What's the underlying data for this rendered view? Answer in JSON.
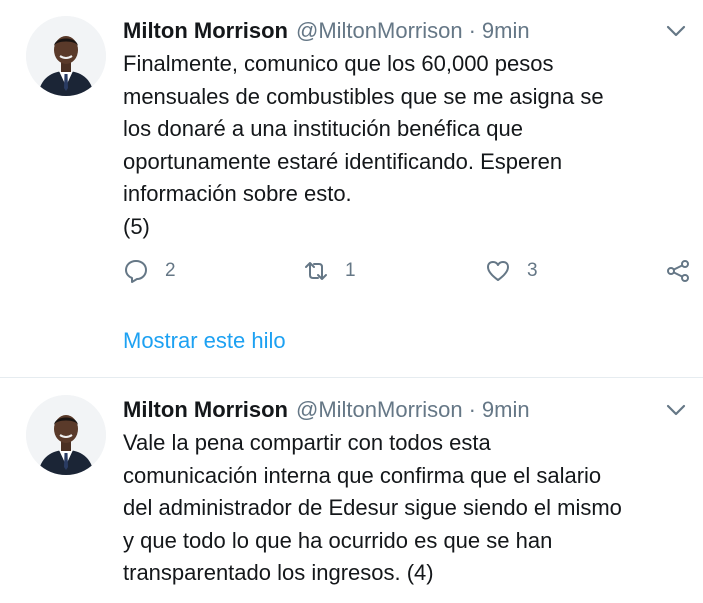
{
  "tweets": [
    {
      "name": "Milton Morrison",
      "handle": "@MiltonMorrison",
      "separator": "·",
      "time": "9min",
      "lines": [
        "Finalmente, comunico que los 60,000 pesos",
        "mensuales de combustibles que se me asigna se",
        "los donaré a una institución benéfica que",
        "oportunamente estaré identificando. Esperen",
        "información sobre esto.",
        "(5)"
      ],
      "replies": "2",
      "retweets": "1",
      "likes": "3",
      "thread_link": "Mostrar este hilo"
    },
    {
      "name": "Milton Morrison",
      "handle": "@MiltonMorrison",
      "separator": "·",
      "time": "9min",
      "lines": [
        "Vale la pena compartir con todos esta",
        "comunicación interna que confirma que el salario",
        "del administrador de Edesur sigue siendo el mismo",
        "y que todo lo que ha ocurrido es que se han",
        "transparentado los ingresos. (4)"
      ]
    }
  ],
  "icons": {
    "avatar": "profile-photo",
    "menu": "chevron-down-icon",
    "reply": "reply-icon",
    "retweet": "retweet-icon",
    "like": "heart-icon",
    "share": "share-icon"
  },
  "colors": {
    "text": "#14171a",
    "muted": "#657786",
    "link": "#1da1f2",
    "divider": "#e6ecf0"
  }
}
